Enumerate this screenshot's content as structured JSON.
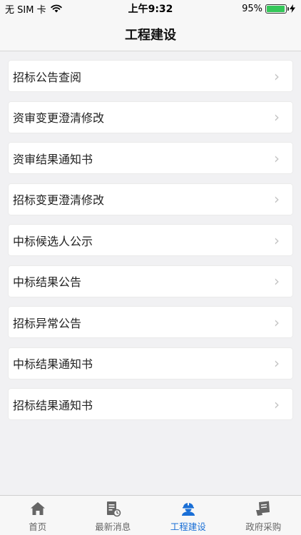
{
  "status": {
    "carrier": "无 SIM 卡",
    "time": "上午9:32",
    "battery": "95%",
    "battery_level": 0.95
  },
  "nav": {
    "title": "工程建设"
  },
  "menu": [
    {
      "label": "招标公告查阅"
    },
    {
      "label": "资审变更澄清修改"
    },
    {
      "label": "资审结果通知书"
    },
    {
      "label": "招标变更澄清修改"
    },
    {
      "label": "中标候选人公示"
    },
    {
      "label": "中标结果公告"
    },
    {
      "label": "招标异常公告"
    },
    {
      "label": "中标结果通知书"
    },
    {
      "label": "招标结果通知书"
    }
  ],
  "tabs": [
    {
      "label": "首页",
      "icon": "home-icon",
      "active": false
    },
    {
      "label": "最新消息",
      "icon": "document-icon",
      "active": false
    },
    {
      "label": "工程建设",
      "icon": "worker-icon",
      "active": true
    },
    {
      "label": "政府采购",
      "icon": "purchase-icon",
      "active": false
    }
  ],
  "colors": {
    "accent": "#1a6fd6",
    "inactive": "#666666",
    "battery": "#34c759"
  }
}
